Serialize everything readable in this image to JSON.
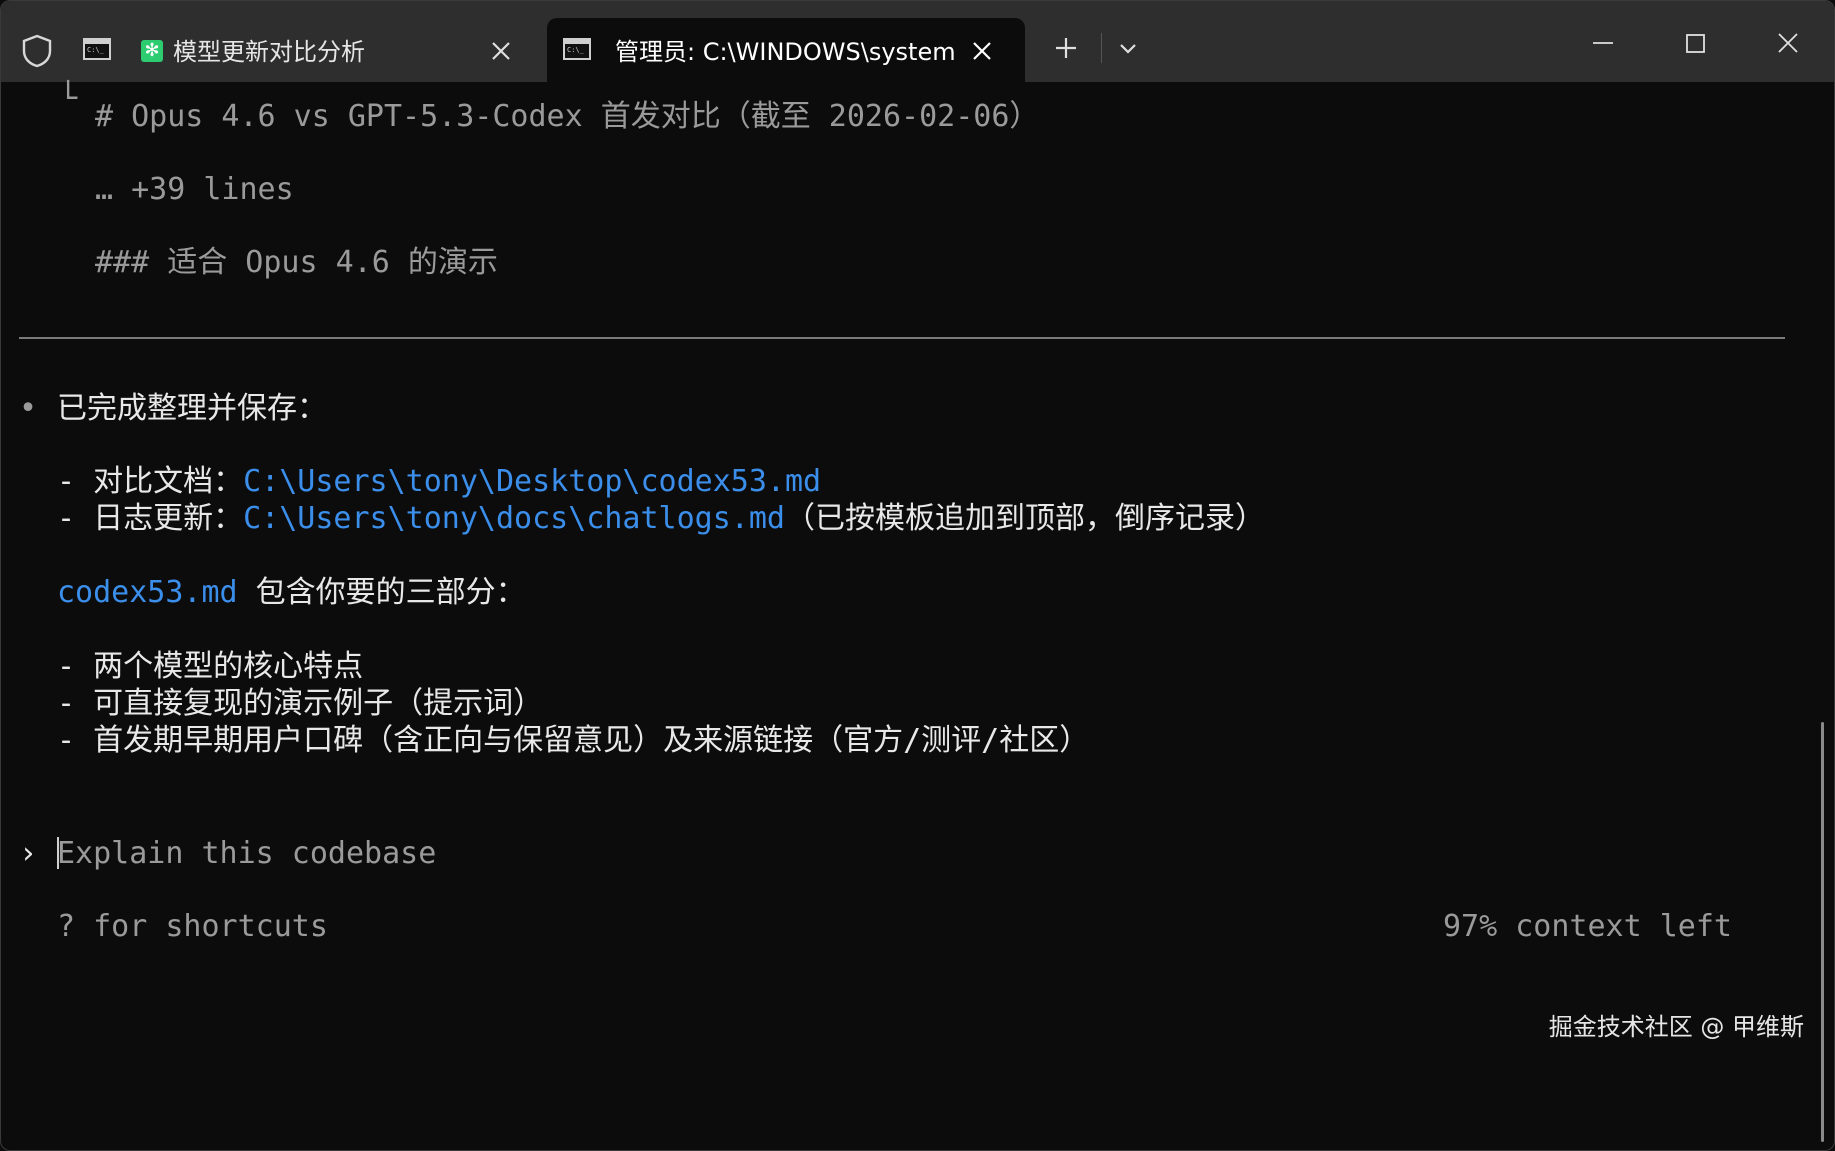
{
  "titlebar": {
    "tabs": [
      {
        "title": "模型更新对比分析",
        "icon": "terminal-icon",
        "status_icon": "✻",
        "status_color": "#2ecc71"
      },
      {
        "title": "管理员:  C:\\WINDOWS\\system",
        "icon": "terminal-icon",
        "active": true
      }
    ],
    "new_tab": "+",
    "dropdown": "chevron-down-icon",
    "window_controls": [
      "minimize-icon",
      "maximize-icon",
      "close-icon"
    ]
  },
  "terminal": {
    "prev_output": {
      "tree_char": "└",
      "heading": "# Opus 4.6 vs GPT-5.3-Codex 首发对比（截至 2026-02-06）",
      "collapsed": "… +39 lines",
      "subheading": "### 适合 Opus 4.6 的演示"
    },
    "response": {
      "bullet": "•",
      "intro": "已完成整理并保存：",
      "item1_prefix": "- 对比文档：",
      "item1_path": "C:\\Users\\tony\\Desktop\\codex53.md",
      "item2_prefix": "- 日志更新：",
      "item2_path": "C:\\Users\\tony\\docs\\chatlogs.md",
      "item2_suffix": "（已按模板追加到顶部，倒序记录）",
      "file_name": "codex53.md",
      "file_desc": " 包含你要的三部分：",
      "parts": [
        "- 两个模型的核心特点",
        "- 可直接复现的演示例子（提示词）",
        "- 首发期早期用户口碑（含正向与保留意见）及来源链接（官方/测评/社区）"
      ]
    },
    "prompt": {
      "caret": "›",
      "placeholder": "Explain this codebase"
    },
    "footer": {
      "shortcuts": "? for shortcuts",
      "context": "97% context left"
    },
    "colors": {
      "background": "#0c0c0c",
      "text": "#e8e8e8",
      "dim": "#9a9a9a",
      "path": "#3b8eea"
    }
  },
  "watermark": "掘金技术社区 @ 甲维斯"
}
